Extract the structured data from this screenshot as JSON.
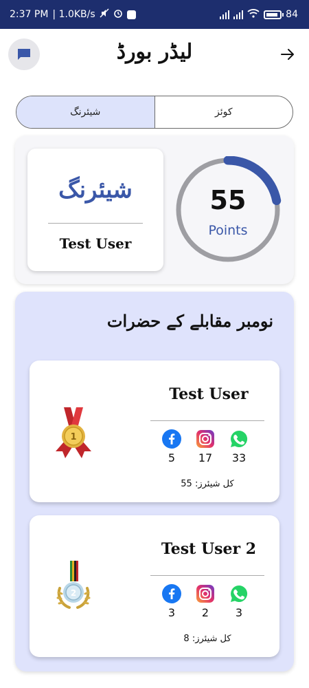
{
  "status_bar": {
    "time": "2:37 PM",
    "speed": "| 1.0KB/s",
    "battery": "84"
  },
  "header": {
    "title": "لیڈر بورڈ"
  },
  "tabs": [
    {
      "label": "شیئرنگ",
      "active": true
    },
    {
      "label": "کوئز",
      "active": false
    }
  ],
  "score": {
    "category": "شیئرنگ",
    "user_name": "Test User",
    "points_value": "55",
    "points_label": "Points",
    "progress_fraction": 0.22
  },
  "winners": {
    "title": "نومبر مقابلے کے حضرات",
    "total_label": "کل شیئرز:",
    "items": [
      {
        "rank": "1",
        "name": "Test User",
        "facebook": "5",
        "instagram": "17",
        "whatsapp": "33",
        "total": "55"
      },
      {
        "rank": "2",
        "name": "Test User 2",
        "facebook": "3",
        "instagram": "2",
        "whatsapp": "3",
        "total": "8"
      }
    ]
  },
  "colors": {
    "status_bar": "#1d2e6e",
    "accent": "#3a57a8",
    "panel": "#dfe3fc"
  }
}
